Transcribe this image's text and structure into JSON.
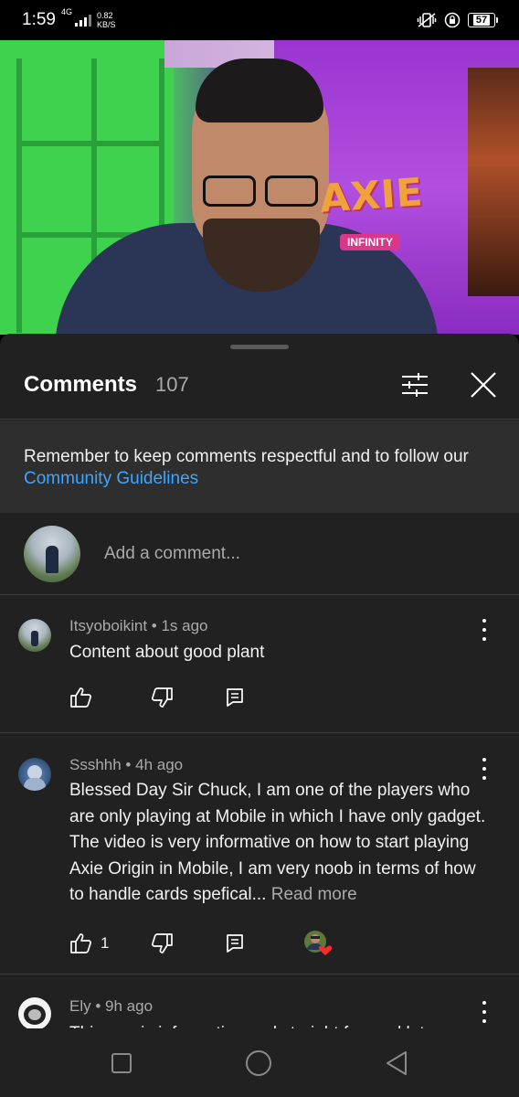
{
  "status_bar": {
    "time": "1:59",
    "network_type": "4G",
    "speed_value": "0.82",
    "speed_unit": "KB/S",
    "battery": "57"
  },
  "video": {
    "logo_text": "AXIE",
    "logo_subtext": "INFINITY"
  },
  "comments_panel": {
    "title": "Comments",
    "count": "107",
    "notice_text": "Remember to keep comments respectful and to follow our",
    "notice_link": "Community Guidelines",
    "add_comment_placeholder": "Add a comment...",
    "comments": [
      {
        "author": "Itsyoboikint",
        "time": "1s ago",
        "text": "Content about good plant",
        "likes": ""
      },
      {
        "author": "Ssshhh",
        "time": "4h ago",
        "text": "Blessed Day Sir Chuck, I am one of the players who are only playing at Mobile in which I have only gadget. The video is very informative on how to start playing Axie Origin in Mobile, I am very noob in terms of how to handle cards spefical...",
        "read_more": "Read more",
        "likes": "1"
      },
      {
        "author": "Ely",
        "time": "9h ago",
        "text": "This one is informative and straight forward lot..."
      }
    ]
  },
  "colors": {
    "sheet_bg": "#212121",
    "notice_bg": "#2e2e2e",
    "link": "#3ea6ff",
    "progress_played": "#ff0000"
  }
}
